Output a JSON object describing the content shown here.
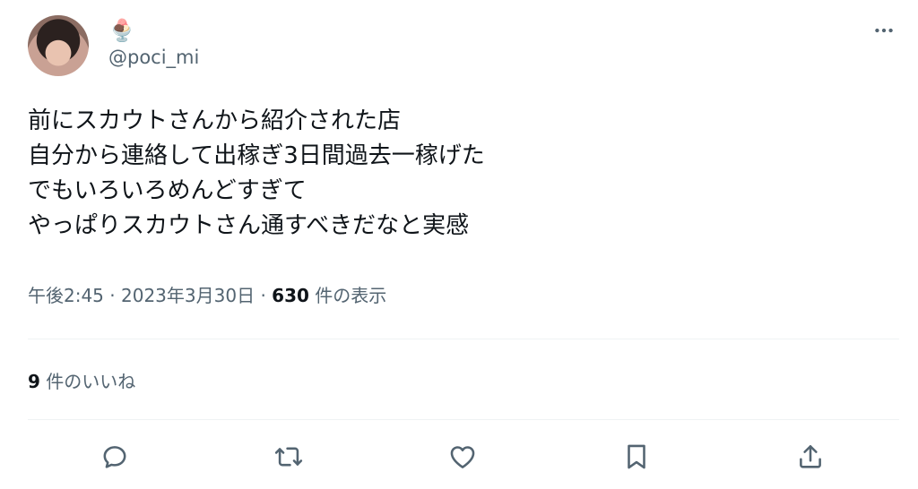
{
  "author": {
    "display_name_emoji": "🍨",
    "handle": "@poci_mi"
  },
  "tweet": {
    "lines": [
      "前にスカウトさんから紹介された店",
      "自分から連絡して出稼ぎ3日間過去一稼げた",
      "でもいろいろめんどすぎて",
      "やっぱりスカウトさん通すべきだなと実感"
    ],
    "time": "午後2:45",
    "separator": "·",
    "date": "2023年3月30日",
    "views_count": "630",
    "views_label": "件の表示"
  },
  "engagement": {
    "likes_count": "9",
    "likes_label": "件のいいね"
  },
  "icons": {
    "more": "more-icon",
    "reply": "reply-icon",
    "retweet": "retweet-icon",
    "like": "heart-icon",
    "bookmark": "bookmark-icon",
    "share": "share-icon"
  },
  "colors": {
    "text": "#0f1419",
    "secondary": "#536471",
    "divider": "#eff3f4"
  }
}
